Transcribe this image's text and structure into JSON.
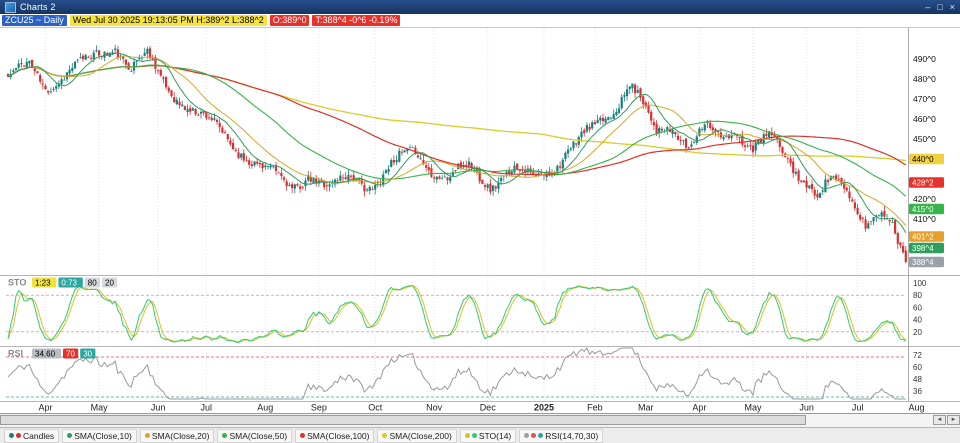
{
  "window": {
    "title": "Charts 2",
    "controls": {
      "minimize": "–",
      "maximize": "□",
      "close": "×"
    }
  },
  "status_bar": {
    "symbol": "ZCU25 ~ Daily",
    "crosshair_info": "Wed Jul 30 2025 19:13:05 PM  H:389^2 L:388^2",
    "open_info": "O:389^0",
    "last_info": "T:388^4 -0^6 -0.19%"
  },
  "colors": {
    "candle_up": "#17807e",
    "candle_down": "#d63031",
    "sma10": "#2e9e5b",
    "sma20": "#d9a62b",
    "sma50": "#35b44a",
    "sma100": "#e03028",
    "sma200": "#d8cc2a",
    "sto_k": "#2ecc71",
    "sto_d": "#e0c02a",
    "rsi": "#999999",
    "grid": "#e2e2e2",
    "separator": "#b5b5b5",
    "axis_border": "#aaaaaa",
    "level_red": "#e87070",
    "level_teal": "#2aa8a0"
  },
  "chart_data": {
    "type": "candlestick",
    "symbol": "ZCU25",
    "timeframe": "Daily",
    "n_candles": 336,
    "last_close": 388.5,
    "price_range_visible": [
      384,
      505
    ],
    "noise_seed": 11,
    "wiggle": {
      "sin_amp": 3.2,
      "sin_freq": 0.27,
      "noise_amp": 4
    },
    "close_keypoints": [
      [
        0,
        481
      ],
      [
        8,
        486
      ],
      [
        14,
        476
      ],
      [
        22,
        484
      ],
      [
        32,
        490
      ],
      [
        40,
        497
      ],
      [
        46,
        486
      ],
      [
        52,
        491
      ],
      [
        58,
        478
      ],
      [
        66,
        468
      ],
      [
        74,
        459
      ],
      [
        82,
        450
      ],
      [
        90,
        441
      ],
      [
        98,
        432
      ],
      [
        106,
        426
      ],
      [
        112,
        433
      ],
      [
        120,
        424
      ],
      [
        128,
        432
      ],
      [
        136,
        427
      ],
      [
        144,
        437
      ],
      [
        152,
        445
      ],
      [
        158,
        436
      ],
      [
        164,
        429
      ],
      [
        172,
        436
      ],
      [
        180,
        428
      ],
      [
        188,
        434
      ],
      [
        196,
        430
      ],
      [
        204,
        438
      ],
      [
        212,
        447
      ],
      [
        220,
        457
      ],
      [
        228,
        470
      ],
      [
        232,
        478
      ],
      [
        236,
        469
      ],
      [
        242,
        452
      ],
      [
        248,
        457
      ],
      [
        254,
        447
      ],
      [
        260,
        456
      ],
      [
        266,
        449
      ],
      [
        272,
        455
      ],
      [
        278,
        446
      ],
      [
        284,
        450
      ],
      [
        290,
        441
      ],
      [
        296,
        432
      ],
      [
        302,
        423
      ],
      [
        308,
        429
      ],
      [
        314,
        420
      ],
      [
        320,
        410
      ],
      [
        325,
        414
      ],
      [
        329,
        408
      ],
      [
        332,
        396
      ],
      [
        335,
        388.5
      ]
    ],
    "months": [
      {
        "label": "Apr",
        "i": 14
      },
      {
        "label": "May",
        "i": 34
      },
      {
        "label": "Jun",
        "i": 56
      },
      {
        "label": "Jul",
        "i": 74
      },
      {
        "label": "Aug",
        "i": 96
      },
      {
        "label": "Sep",
        "i": 116
      },
      {
        "label": "Oct",
        "i": 137
      },
      {
        "label": "Nov",
        "i": 159
      },
      {
        "label": "Dec",
        "i": 179
      },
      {
        "label": "2025",
        "i": 200
      },
      {
        "label": "Feb",
        "i": 219
      },
      {
        "label": "Mar",
        "i": 238
      },
      {
        "label": "Apr",
        "i": 258
      },
      {
        "label": "May",
        "i": 278
      },
      {
        "label": "Jun",
        "i": 298
      },
      {
        "label": "Jul",
        "i": 317
      },
      {
        "label": "Aug",
        "i": 339
      }
    ],
    "price_axis": [
      {
        "text": "490^0",
        "price": 490,
        "type": "plain"
      },
      {
        "text": "480^0",
        "price": 480,
        "type": "plain"
      },
      {
        "text": "470^0",
        "price": 470,
        "type": "plain"
      },
      {
        "text": "460^0",
        "price": 460,
        "type": "plain"
      },
      {
        "text": "450^0",
        "price": 450,
        "type": "plain"
      },
      {
        "text": "440^0",
        "price": 440,
        "type": "badge",
        "bg": "#f2d23c",
        "fg": "#000"
      },
      {
        "text": "428^2",
        "price": 428.25,
        "type": "badge",
        "bg": "#e8312a",
        "fg": "#fff"
      },
      {
        "text": "420^0",
        "price": 420,
        "type": "plain"
      },
      {
        "text": "415^0",
        "price": 415,
        "type": "badge",
        "bg": "#35b44a",
        "fg": "#fff"
      },
      {
        "text": "410^0",
        "price": 410,
        "type": "plain"
      },
      {
        "text": "401^2",
        "price": 401.25,
        "type": "badge",
        "bg": "#e8a02c",
        "fg": "#fff"
      },
      {
        "text": "398^4",
        "price": 398.5,
        "type": "badge",
        "bg": "#2e9e5b",
        "fg": "#fff"
      },
      {
        "text": "388^4",
        "price": 388.5,
        "type": "badge",
        "bg": "#9aa0a6",
        "fg": "#fff"
      }
    ],
    "overlays": [
      {
        "name": "SMA(Close,200)",
        "period": 200,
        "color_key": "sma200",
        "width": 1.3
      },
      {
        "name": "SMA(Close,100)",
        "period": 100,
        "color_key": "sma100",
        "width": 1.2
      },
      {
        "name": "SMA(Close,50)",
        "period": 50,
        "color_key": "sma50",
        "width": 1.1
      },
      {
        "name": "SMA(Close,20)",
        "period": 20,
        "color_key": "sma20",
        "width": 1.0
      },
      {
        "name": "SMA(Close,10)",
        "period": 10,
        "color_key": "sma10",
        "width": 1.0
      }
    ],
    "sto": {
      "label": "STO",
      "k_period": 14,
      "badges": [
        {
          "text": "1:23",
          "bg": "#f0e13c",
          "fg": "#000"
        },
        {
          "text": "0:73",
          "bg": "#2aa8a0",
          "fg": "#fff"
        },
        {
          "text": "80",
          "bg": "#d6d9dc",
          "fg": "#000"
        },
        {
          "text": "20",
          "bg": "#d6d9dc",
          "fg": "#000"
        }
      ],
      "ticks": [
        100,
        80,
        60,
        40,
        20
      ],
      "levels": [
        80,
        20
      ]
    },
    "rsi": {
      "label": "RSI",
      "period": 14,
      "current": "34.60",
      "badges": [
        {
          "text": "34.60",
          "bg": "#b9bec4",
          "fg": "#000"
        },
        {
          "text": "70",
          "bg": "#e8312a",
          "fg": "#fff"
        },
        {
          "text": "30",
          "bg": "#2aa8a0",
          "fg": "#fff"
        }
      ],
      "ticks": [
        72,
        60,
        48,
        36
      ],
      "levels": {
        "upper": 70,
        "lower": 30
      }
    }
  },
  "scrollbar": {
    "thumb_pct": 84,
    "left_arrow": "◄",
    "right_arrow": "►"
  },
  "legend": {
    "items": [
      {
        "label": "Candles",
        "dots": [
          "#17807e",
          "#d63031"
        ]
      },
      {
        "label": "SMA(Close,10)",
        "dots": [
          "#2e9e5b"
        ]
      },
      {
        "label": "SMA(Close,20)",
        "dots": [
          "#d9a62b"
        ]
      },
      {
        "label": "SMA(Close,50)",
        "dots": [
          "#35b44a"
        ]
      },
      {
        "label": "SMA(Close,100)",
        "dots": [
          "#e03028"
        ]
      },
      {
        "label": "SMA(Close,200)",
        "dots": [
          "#d8cc2a"
        ]
      },
      {
        "label": "STO(14)",
        "dots": [
          "#e0c02a",
          "#2ecc71"
        ]
      },
      {
        "label": "RSI(14,70,30)",
        "dots": [
          "#9aa0a6",
          "#e05050",
          "#2aa8a0"
        ]
      }
    ]
  }
}
